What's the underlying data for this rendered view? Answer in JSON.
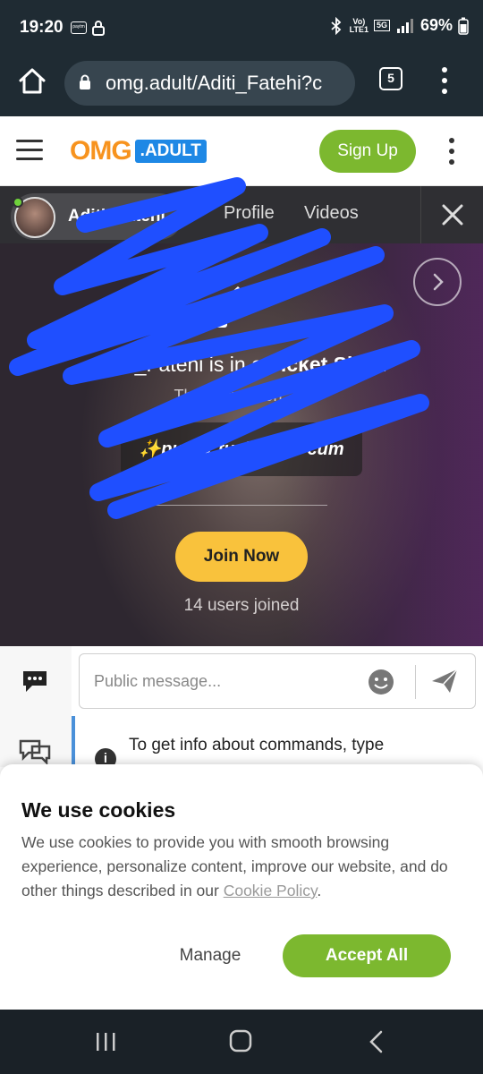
{
  "status_bar": {
    "time": "19:20",
    "paytm_label": "paytm",
    "network_label_top": "Vo)",
    "network_label_bottom": "LTE1",
    "network_type": "5G",
    "battery": "69%"
  },
  "browser": {
    "url": "omg.adult/Aditi_Fatehi?c",
    "tab_count": "5"
  },
  "site_header": {
    "logo_omg": "OMG",
    "logo_adult": ".ADULT",
    "signup_label": "Sign Up"
  },
  "tabs": {
    "model_name": "Aditi_Fatehi",
    "profile_label": "Profile",
    "videos_label": "Videos"
  },
  "video": {
    "title_prefix": "Aditi_Fatehi is in a ",
    "title_bold": "Ticket Show",
    "subtitle": "The show is on: 33",
    "show_name": "✨pussy fuck dildo cum",
    "join_label": "Join Now",
    "users_joined": "14 users joined"
  },
  "chat": {
    "placeholder": "Public message...",
    "info_text": "To get info about commands, type"
  },
  "cookie_banner": {
    "title": "We use cookies",
    "body": "We use cookies to provide you with smooth browsing experience, personalize content, improve our website, and do other things described in our ",
    "link_text": "Cookie Policy",
    "body_end": ".",
    "manage_label": "Manage",
    "accept_label": "Accept All"
  },
  "icons": {
    "home": "home-icon",
    "lock": "lock-icon",
    "menu": "hamburger-icon",
    "kebab": "more-vert-icon",
    "close": "close-icon",
    "next": "chevron-right-icon",
    "ticket": "ticket-icon",
    "chat": "chat-bubble-icon",
    "users": "users-chat-icon",
    "smiley": "smiley-icon",
    "send": "send-icon",
    "info": "info-icon"
  },
  "colors": {
    "accent_green": "#7cb82f",
    "join_yellow": "#f9c23c",
    "logo_orange": "#f7931e",
    "logo_blue": "#1e88e5",
    "scribble_blue": "#1f4fff"
  }
}
